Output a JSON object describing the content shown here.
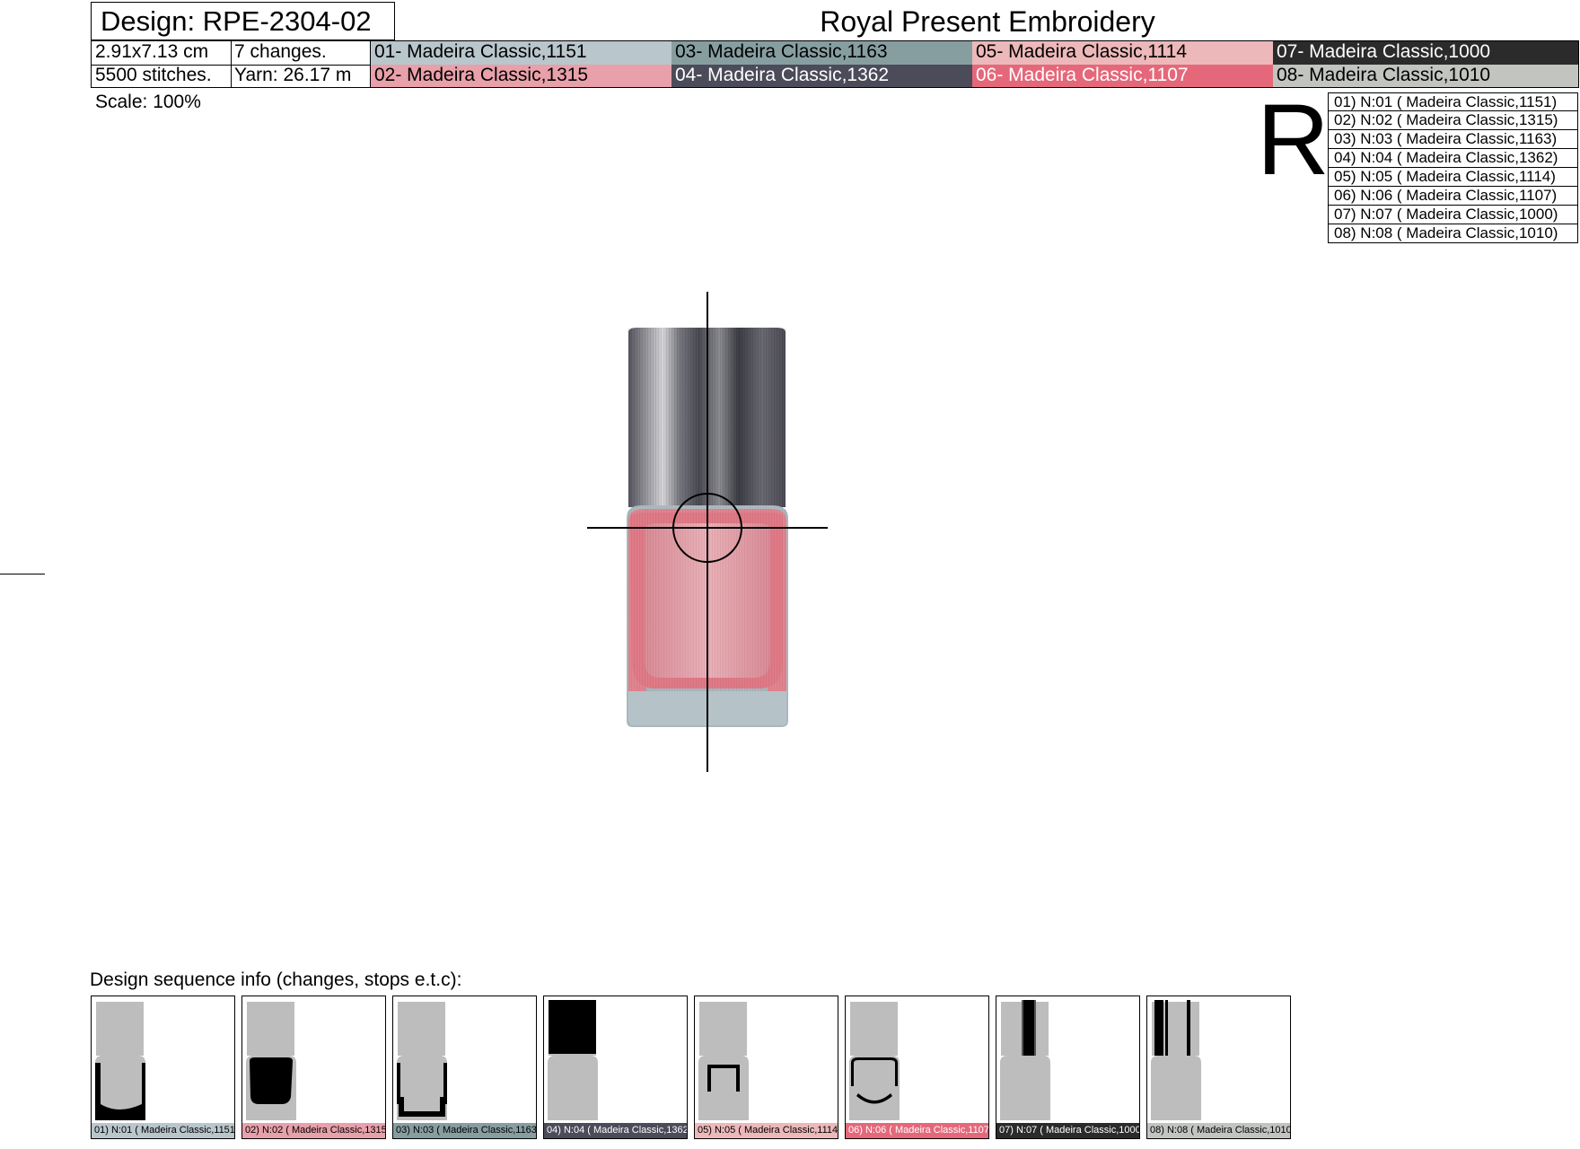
{
  "header": {
    "design_title": "Design: RPE-2304-02",
    "company": "Royal Present Embroidery",
    "size": "2.91x7.13 cm",
    "changes": "7 changes.",
    "stitches": "5500 stitches.",
    "yarn": "Yarn: 26.17 m"
  },
  "colors": [
    {
      "label": "01- Madeira Classic,1151",
      "bg": "#b9c6cc",
      "fg": "#000000"
    },
    {
      "label": "02- Madeira Classic,1315",
      "bg": "#e8a0aa",
      "fg": "#000000"
    },
    {
      "label": "03- Madeira Classic,1163",
      "bg": "#879ea1",
      "fg": "#000000"
    },
    {
      "label": "04- Madeira Classic,1362",
      "bg": "#4c4b5a",
      "fg": "#ffffff"
    },
    {
      "label": "05- Madeira Classic,1114",
      "bg": "#edb8b9",
      "fg": "#000000"
    },
    {
      "label": "06- Madeira Classic,1107",
      "bg": "#e5687a",
      "fg": "#ffffff"
    },
    {
      "label": "07- Madeira Classic,1000",
      "bg": "#2b2b2b",
      "fg": "#ffffff"
    },
    {
      "label": "08- Madeira Classic,1010",
      "bg": "#c2c4c0",
      "fg": "#000000"
    }
  ],
  "scale": "Scale: 100%",
  "orientation_mark": "R",
  "legend": [
    "01) N:01 ( Madeira Classic,1151)",
    "02) N:02 ( Madeira Classic,1315)",
    "03) N:03 ( Madeira Classic,1163)",
    "04) N:04 ( Madeira Classic,1362)",
    "05) N:05 ( Madeira Classic,1114)",
    "06) N:06 ( Madeira Classic,1107)",
    "07) N:07 ( Madeira Classic,1000)",
    "08) N:08 ( Madeira Classic,1010)"
  ],
  "sequence": {
    "label": "Design sequence info (changes, stops e.t.c):",
    "steps": [
      {
        "caption": "01) N:01 ( Madeira Classic,1151",
        "bg": "#b9c6cc",
        "fg": "#000000",
        "highlight": "bottom-outline"
      },
      {
        "caption": "02) N:02 ( Madeira Classic,1315",
        "bg": "#e8a0aa",
        "fg": "#000000",
        "highlight": "bottom-fill"
      },
      {
        "caption": "03) N:03 ( Madeira Classic,1163",
        "bg": "#879ea1",
        "fg": "#000000",
        "highlight": "bottom-edge"
      },
      {
        "caption": "04) N:04 ( Madeira Classic,1362",
        "bg": "#4c4b5a",
        "fg": "#ffffff",
        "highlight": "cap-fill"
      },
      {
        "caption": "05) N:05 ( Madeira Classic,1114",
        "bg": "#edb8b9",
        "fg": "#000000",
        "highlight": "inner-frame"
      },
      {
        "caption": "06) N:06 ( Madeira Classic,1107",
        "bg": "#e5687a",
        "fg": "#ffffff",
        "highlight": "rim"
      },
      {
        "caption": "07) N:07 ( Madeira Classic,1000",
        "bg": "#2b2b2b",
        "fg": "#ffffff",
        "highlight": "cap-stripe"
      },
      {
        "caption": "08) N:08 ( Madeira Classic,1010",
        "bg": "#c2c4c0",
        "fg": "#000000",
        "highlight": "cap-stripes"
      }
    ]
  }
}
